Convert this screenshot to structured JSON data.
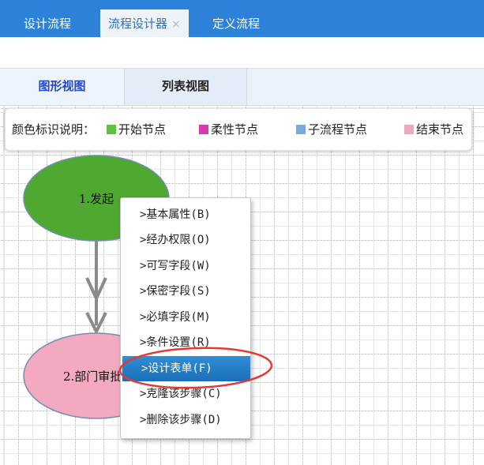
{
  "top_tabs": [
    {
      "label": "设计流程"
    },
    {
      "label": "流程设计器",
      "close": "×"
    },
    {
      "label": "定义流程"
    }
  ],
  "view_tabs": [
    {
      "label": "图形视图"
    },
    {
      "label": "列表视图"
    }
  ],
  "legend": {
    "title": "颜色标识说明：",
    "items": [
      {
        "label": "开始节点",
        "color": "#5fc23e"
      },
      {
        "label": "柔性节点",
        "color": "#d63ab5"
      },
      {
        "label": "子流程节点",
        "color": "#7aa7e0"
      },
      {
        "label": "结束节点",
        "color": "#f0a8c0"
      }
    ]
  },
  "nodes": [
    {
      "label": "1.发起",
      "color": "#4fa82f"
    },
    {
      "label": "2.部门审批",
      "color": "#f3a9c0"
    }
  ],
  "context_menu": {
    "items": [
      {
        "label": ">基本属性(B)"
      },
      {
        "label": ">经办权限(O)"
      },
      {
        "label": ">可写字段(W)"
      },
      {
        "label": ">保密字段(S)"
      },
      {
        "label": ">必填字段(M)"
      },
      {
        "label": ">条件设置(R)"
      },
      {
        "label": ">设计表单(F)",
        "highlighted": true
      },
      {
        "label": ">克隆该步骤(C)"
      },
      {
        "label": ">删除该步骤(D)"
      }
    ]
  },
  "colors": {
    "topbar": "#2b82d8",
    "menu_highlight": "#1f7cc4",
    "annotation_ring": "#e53935"
  }
}
